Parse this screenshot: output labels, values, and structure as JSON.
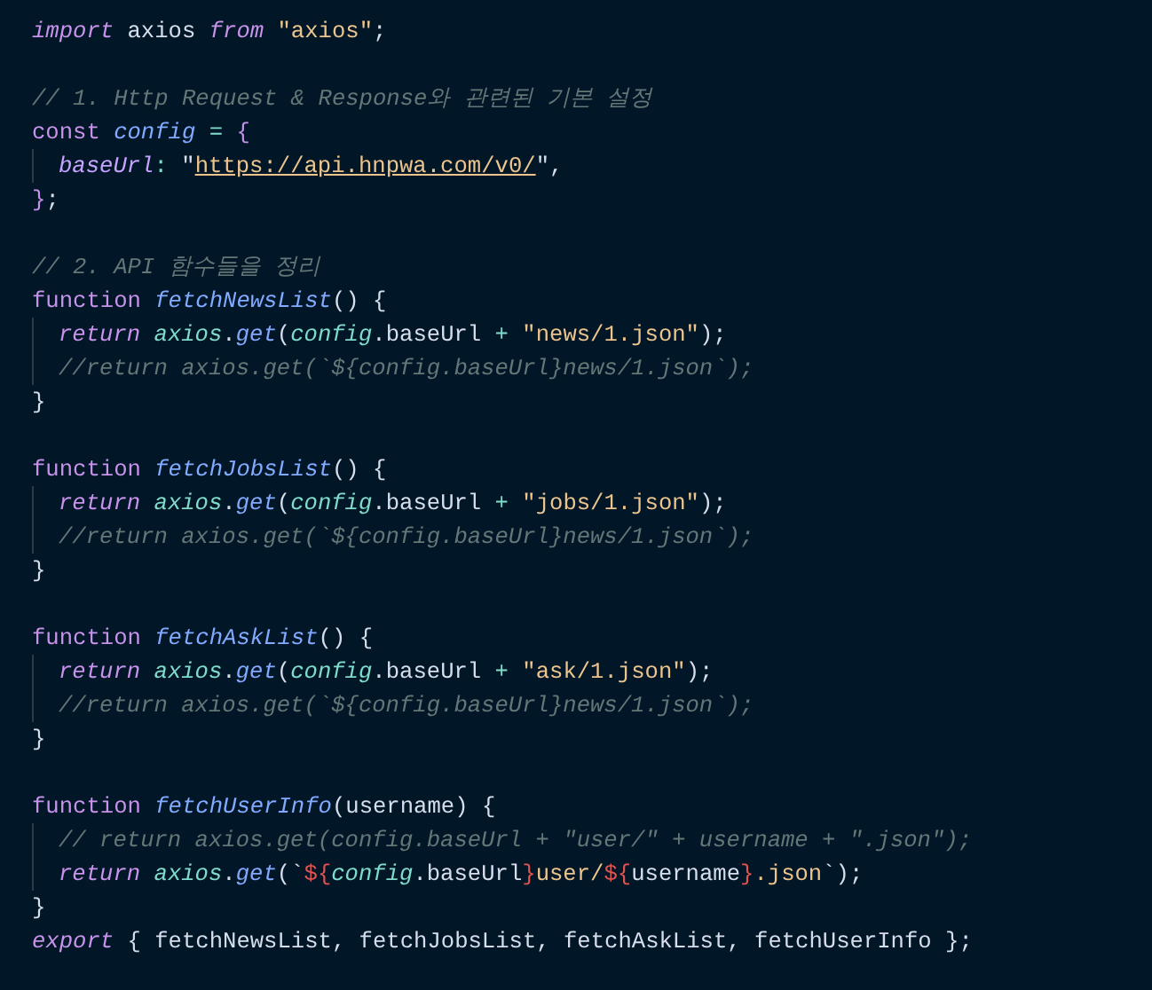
{
  "editor": {
    "lines": [
      {
        "indented": false,
        "tokens": [
          {
            "kind": "kwi",
            "text": "import"
          },
          {
            "kind": "plain",
            "text": " axios "
          },
          {
            "kind": "kwi",
            "text": "from "
          },
          {
            "kind": "str",
            "text": "\"axios\""
          },
          {
            "kind": "plain",
            "text": ";"
          }
        ]
      },
      {
        "indented": false
      },
      {
        "indented": false,
        "tokens": [
          {
            "kind": "cmt",
            "text": "// 1. Http Request & Response와 관련된 기본 설정"
          }
        ]
      },
      {
        "indented": false,
        "tokens": [
          {
            "kind": "kw",
            "text": "const "
          },
          {
            "kind": "fn",
            "text": "config "
          },
          {
            "kind": "op",
            "text": "= "
          },
          {
            "kind": "kw",
            "text": "{"
          }
        ]
      },
      {
        "indented": true,
        "tokens": [
          {
            "kind": "prop",
            "text": "baseUrl"
          },
          {
            "kind": "op",
            "text": ":"
          },
          {
            "kind": "plain",
            "text": " \""
          },
          {
            "kind": "url",
            "text": "https://api.hnpwa.com/v0/"
          },
          {
            "kind": "plain",
            "text": "\","
          }
        ]
      },
      {
        "indented": false,
        "tokens": [
          {
            "kind": "kw",
            "text": "}"
          },
          {
            "kind": "plain",
            "text": ";"
          }
        ]
      },
      {
        "indented": false
      },
      {
        "indented": false,
        "tokens": [
          {
            "kind": "cmt",
            "text": "// 2. API 함수들을 정리"
          }
        ]
      },
      {
        "indented": false,
        "tokens": [
          {
            "kind": "kw",
            "text": "function "
          },
          {
            "kind": "fn",
            "text": "fetchNewsList"
          },
          {
            "kind": "plain",
            "text": "() {"
          }
        ]
      },
      {
        "indented": true,
        "tokens": [
          {
            "kind": "kwi",
            "text": "return "
          },
          {
            "kind": "var",
            "text": "axios"
          },
          {
            "kind": "plain",
            "text": "."
          },
          {
            "kind": "fn",
            "text": "get"
          },
          {
            "kind": "plain",
            "text": "("
          },
          {
            "kind": "var",
            "text": "config"
          },
          {
            "kind": "plain",
            "text": ".baseUrl "
          },
          {
            "kind": "op",
            "text": "+ "
          },
          {
            "kind": "str",
            "text": "\"news/1.json\""
          },
          {
            "kind": "plain",
            "text": ");"
          }
        ]
      },
      {
        "indented": true,
        "tokens": [
          {
            "kind": "cmt",
            "text": "//return axios.get(`${config.baseUrl}news/1.json`);"
          }
        ]
      },
      {
        "indented": false,
        "tokens": [
          {
            "kind": "plain",
            "text": "}"
          }
        ]
      },
      {
        "indented": false
      },
      {
        "indented": false,
        "tokens": [
          {
            "kind": "kw",
            "text": "function "
          },
          {
            "kind": "fn",
            "text": "fetchJobsList"
          },
          {
            "kind": "plain",
            "text": "() {"
          }
        ]
      },
      {
        "indented": true,
        "tokens": [
          {
            "kind": "kwi",
            "text": "return "
          },
          {
            "kind": "var",
            "text": "axios"
          },
          {
            "kind": "plain",
            "text": "."
          },
          {
            "kind": "fn",
            "text": "get"
          },
          {
            "kind": "plain",
            "text": "("
          },
          {
            "kind": "var",
            "text": "config"
          },
          {
            "kind": "plain",
            "text": ".baseUrl "
          },
          {
            "kind": "op",
            "text": "+ "
          },
          {
            "kind": "str",
            "text": "\"jobs/1.json\""
          },
          {
            "kind": "plain",
            "text": ");"
          }
        ]
      },
      {
        "indented": true,
        "tokens": [
          {
            "kind": "cmt",
            "text": "//return axios.get(`${config.baseUrl}news/1.json`);"
          }
        ]
      },
      {
        "indented": false,
        "tokens": [
          {
            "kind": "plain",
            "text": "}"
          }
        ]
      },
      {
        "indented": false
      },
      {
        "indented": false,
        "tokens": [
          {
            "kind": "kw",
            "text": "function "
          },
          {
            "kind": "fn",
            "text": "fetchAskList"
          },
          {
            "kind": "plain",
            "text": "() {"
          }
        ]
      },
      {
        "indented": true,
        "tokens": [
          {
            "kind": "kwi",
            "text": "return "
          },
          {
            "kind": "var",
            "text": "axios"
          },
          {
            "kind": "plain",
            "text": "."
          },
          {
            "kind": "fn",
            "text": "get"
          },
          {
            "kind": "plain",
            "text": "("
          },
          {
            "kind": "var",
            "text": "config"
          },
          {
            "kind": "plain",
            "text": ".baseUrl "
          },
          {
            "kind": "op",
            "text": "+ "
          },
          {
            "kind": "str",
            "text": "\"ask/1.json\""
          },
          {
            "kind": "plain",
            "text": ");"
          }
        ]
      },
      {
        "indented": true,
        "tokens": [
          {
            "kind": "cmt",
            "text": "//return axios.get(`${config.baseUrl}news/1.json`);"
          }
        ]
      },
      {
        "indented": false,
        "tokens": [
          {
            "kind": "plain",
            "text": "}"
          }
        ]
      },
      {
        "indented": false
      },
      {
        "indented": false,
        "tokens": [
          {
            "kind": "kw",
            "text": "function "
          },
          {
            "kind": "fn",
            "text": "fetchUserInfo"
          },
          {
            "kind": "plain",
            "text": "(username) {"
          }
        ]
      },
      {
        "indented": true,
        "tokens": [
          {
            "kind": "cmt",
            "text": "// return axios.get(config.baseUrl + \"user/\" + username + \".json\");"
          }
        ]
      },
      {
        "indented": true,
        "tokens": [
          {
            "kind": "kwi",
            "text": "return "
          },
          {
            "kind": "var",
            "text": "axios"
          },
          {
            "kind": "plain",
            "text": "."
          },
          {
            "kind": "fn",
            "text": "get"
          },
          {
            "kind": "plain",
            "text": "(`"
          },
          {
            "kind": "tpl",
            "text": "${"
          },
          {
            "kind": "var",
            "text": "config"
          },
          {
            "kind": "plain",
            "text": ".baseUrl"
          },
          {
            "kind": "tpl",
            "text": "}"
          },
          {
            "kind": "str",
            "text": "user/"
          },
          {
            "kind": "tpl",
            "text": "${"
          },
          {
            "kind": "plain",
            "text": "username"
          },
          {
            "kind": "tpl",
            "text": "}"
          },
          {
            "kind": "str",
            "text": ".json"
          },
          {
            "kind": "plain",
            "text": "`);"
          }
        ]
      },
      {
        "indented": false,
        "tokens": [
          {
            "kind": "plain",
            "text": "}"
          }
        ]
      },
      {
        "indented": false,
        "tokens": [
          {
            "kind": "kwi",
            "text": "export"
          },
          {
            "kind": "plain",
            "text": " { fetchNewsList, fetchJobsList, fetchAskList, fetchUserInfo };"
          }
        ]
      }
    ]
  }
}
